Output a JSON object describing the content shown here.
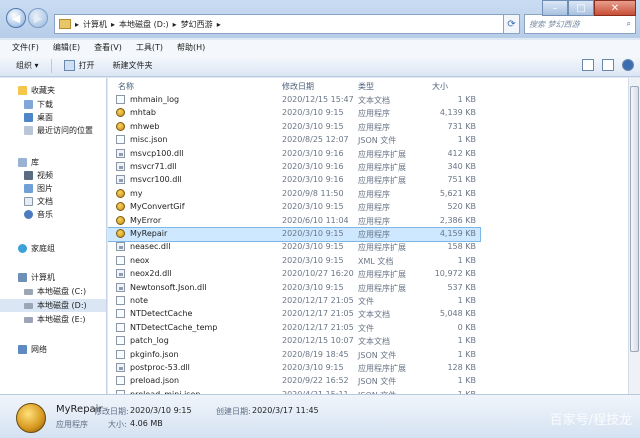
{
  "address": {
    "breadcrumbs": [
      "计算机",
      "本地磁盘 (D:)",
      "梦幻西游"
    ],
    "separator": "▸"
  },
  "search": {
    "placeholder": "搜索 梦幻西游",
    "icon": "search-icon"
  },
  "window_controls": {
    "minimize": "–",
    "maximize": "□",
    "close": "✕"
  },
  "menu": [
    "文件(F)",
    "编辑(E)",
    "查看(V)",
    "工具(T)",
    "帮助(H)"
  ],
  "toolbar": {
    "organize": "组织 ▾",
    "open": "打开",
    "new_folder": "新建文件夹"
  },
  "sidebar": {
    "favorites": "收藏夹",
    "fav_items": [
      "下载",
      "桌面",
      "最近访问的位置"
    ],
    "libraries": "库",
    "lib_items": [
      "视频",
      "图片",
      "文档",
      "音乐"
    ],
    "homegroup": "家庭组",
    "computer": "计算机",
    "drives": [
      "本地磁盘 (C:)",
      "本地磁盘 (D:)",
      "本地磁盘 (E:)"
    ],
    "network": "网络"
  },
  "columns": {
    "name": "名称",
    "date": "修改日期",
    "type": "类型",
    "size": "大小"
  },
  "files": [
    {
      "name": "mhmain_log",
      "date": "2020/12/15 15:47",
      "type": "文本文档",
      "size": "1 KB",
      "icon": "doc"
    },
    {
      "name": "mhtab",
      "date": "2020/3/10 9:15",
      "type": "应用程序",
      "size": "4,139 KB",
      "icon": "exe"
    },
    {
      "name": "mhweb",
      "date": "2020/3/10 9:15",
      "type": "应用程序",
      "size": "731 KB",
      "icon": "exe"
    },
    {
      "name": "misc.json",
      "date": "2020/8/25 12:07",
      "type": "JSON 文件",
      "size": "1 KB",
      "icon": "doc"
    },
    {
      "name": "msvcp100.dll",
      "date": "2020/3/10 9:16",
      "type": "应用程序扩展",
      "size": "412 KB",
      "icon": "dll"
    },
    {
      "name": "msvcr71.dll",
      "date": "2020/3/10 9:16",
      "type": "应用程序扩展",
      "size": "340 KB",
      "icon": "dll"
    },
    {
      "name": "msvcr100.dll",
      "date": "2020/3/10 9:16",
      "type": "应用程序扩展",
      "size": "751 KB",
      "icon": "dll"
    },
    {
      "name": "my",
      "date": "2020/9/8 11:50",
      "type": "应用程序",
      "size": "5,621 KB",
      "icon": "exe"
    },
    {
      "name": "MyConvertGif",
      "date": "2020/3/10 9:15",
      "type": "应用程序",
      "size": "520 KB",
      "icon": "exe"
    },
    {
      "name": "MyError",
      "date": "2020/6/10 11:04",
      "type": "应用程序",
      "size": "2,386 KB",
      "icon": "exe"
    },
    {
      "name": "MyRepair",
      "date": "2020/3/10 9:15",
      "type": "应用程序",
      "size": "4,159 KB",
      "icon": "exe",
      "selected": true
    },
    {
      "name": "neasec.dll",
      "date": "2020/3/10 9:15",
      "type": "应用程序扩展",
      "size": "158 KB",
      "icon": "dll"
    },
    {
      "name": "neox",
      "date": "2020/3/10 9:15",
      "type": "XML 文档",
      "size": "1 KB",
      "icon": "doc"
    },
    {
      "name": "neox2d.dll",
      "date": "2020/10/27 16:20",
      "type": "应用程序扩展",
      "size": "10,972 KB",
      "icon": "dll"
    },
    {
      "name": "Newtonsoft.Json.dll",
      "date": "2020/3/10 9:15",
      "type": "应用程序扩展",
      "size": "537 KB",
      "icon": "dll"
    },
    {
      "name": "note",
      "date": "2020/12/17 21:05",
      "type": "文件",
      "size": "1 KB",
      "icon": "doc"
    },
    {
      "name": "NTDetectCache",
      "date": "2020/12/17 21:05",
      "type": "文本文档",
      "size": "5,048 KB",
      "icon": "doc"
    },
    {
      "name": "NTDetectCache_temp",
      "date": "2020/12/17 21:05",
      "type": "文件",
      "size": "0 KB",
      "icon": "doc"
    },
    {
      "name": "patch_log",
      "date": "2020/12/15 10:07",
      "type": "文本文档",
      "size": "1 KB",
      "icon": "doc"
    },
    {
      "name": "pkginfo.json",
      "date": "2020/8/19 18:45",
      "type": "JSON 文件",
      "size": "1 KB",
      "icon": "doc"
    },
    {
      "name": "postproc-53.dll",
      "date": "2020/3/10 9:15",
      "type": "应用程序扩展",
      "size": "128 KB",
      "icon": "dll"
    },
    {
      "name": "preload.json",
      "date": "2020/9/22 16:52",
      "type": "JSON 文件",
      "size": "1 KB",
      "icon": "doc"
    },
    {
      "name": "preload_mini.json",
      "date": "2020/4/21 15:11",
      "type": "JSON 文件",
      "size": "1 KB",
      "icon": "doc"
    }
  ],
  "status": {
    "name": "MyRepair",
    "modified_label": "修改日期:",
    "modified": "2020/3/10 9:15",
    "created_label": "创建日期:",
    "created": "2020/3/17 11:45",
    "type": "应用程序",
    "size_label": "大小:",
    "size": "4.06 MB"
  },
  "watermark": "百家号/程技龙",
  "colors": {
    "selected_row": "#cde8ff",
    "accent": "#3b6db0"
  }
}
